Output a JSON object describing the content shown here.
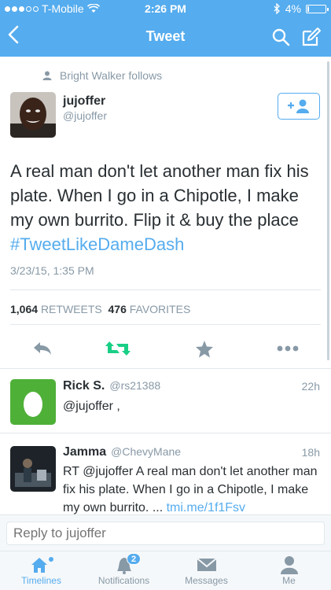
{
  "status": {
    "carrier": "T-Mobile",
    "time": "2:26 PM",
    "battery": "4%",
    "battery_level": 0.04
  },
  "nav": {
    "title": "Tweet"
  },
  "tweet": {
    "follows": "Bright Walker follows",
    "name": "jujoffer",
    "handle": "@jujoffer",
    "text": "A real man don't let another man fix his plate. When I go in a Chipotle, I make my own burrito. Flip it & buy the place ",
    "hashtag": "#TweetLikeDameDash",
    "timestamp": "3/23/15, 1:35 PM",
    "retweets_count": "1,064",
    "retweets_label": "RETWEETS",
    "favorites_count": "476",
    "favorites_label": "FAVORITES"
  },
  "replies": [
    {
      "name": "Rick S.",
      "handle": "@rs21388",
      "time": "22h",
      "text": "@jujoffer ,"
    },
    {
      "name": "Jamma",
      "handle": "@ChevyMane",
      "time": "18h",
      "text": "RT @jujoffer A real man don't let another man fix his plate. When I go in a Chipotle, I make my own burrito. ... ",
      "link": "tmi.me/1f1Fsv"
    }
  ],
  "reply_box": {
    "placeholder": "Reply to jujoffer"
  },
  "tabs": [
    {
      "label": "Timelines"
    },
    {
      "label": "Notifications",
      "badge": "2"
    },
    {
      "label": "Messages"
    },
    {
      "label": "Me"
    }
  ],
  "colors": {
    "accent": "#55acee",
    "retweet": "#19cf86",
    "muted": "#8899a6"
  }
}
